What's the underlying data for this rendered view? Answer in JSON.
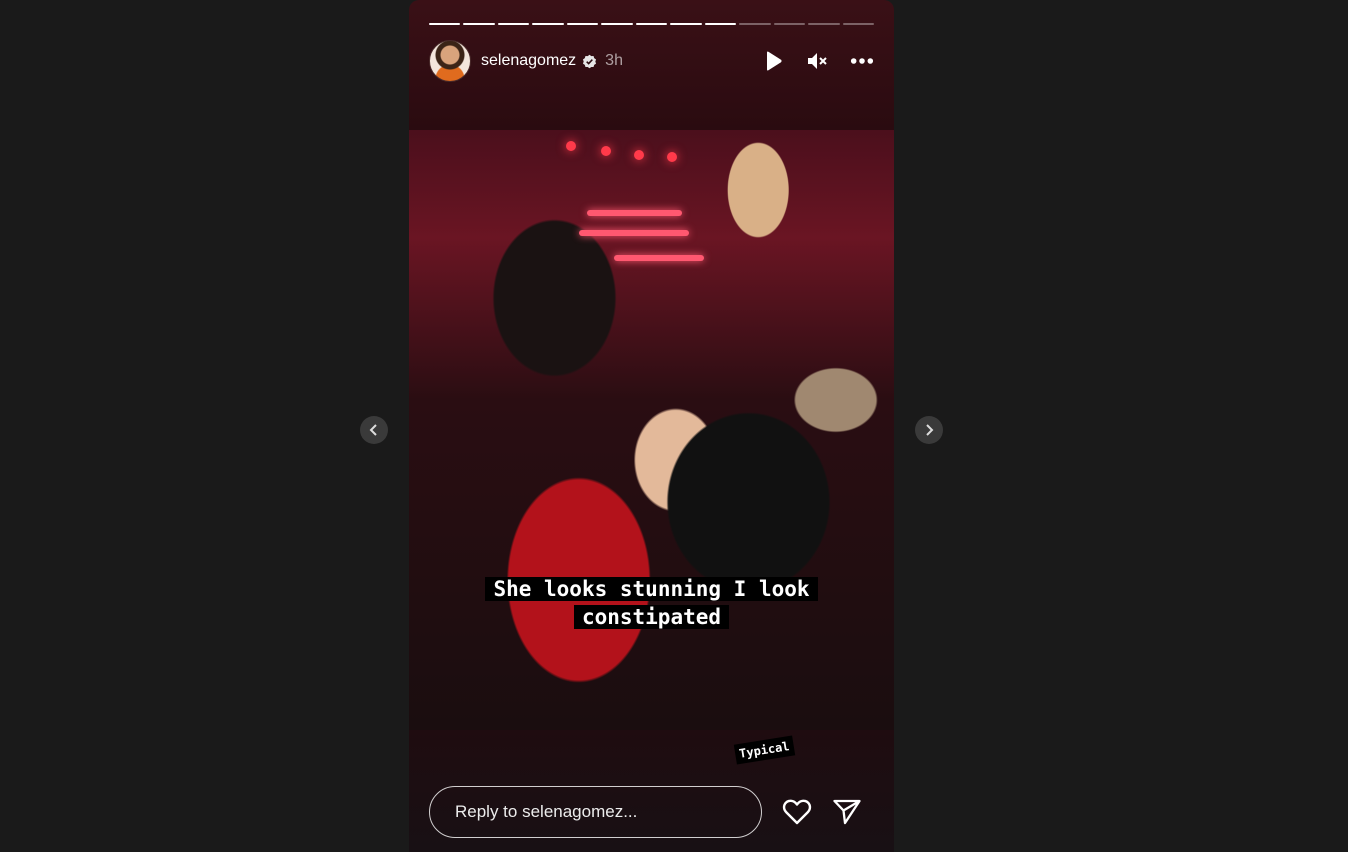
{
  "story": {
    "segments_total": 13,
    "segments_done": 9,
    "username": "selenagomez",
    "time": "3h",
    "verified": true,
    "caption_line1": "She looks stunning I look",
    "caption_line2": "constipated",
    "tag": "Typical",
    "reply_placeholder": "Reply to selenagomez..."
  },
  "icons": {
    "prev": "chevron-left-icon",
    "next": "chevron-right-icon",
    "play": "play-icon",
    "mute": "muted-speaker-icon",
    "more": "more-options-icon",
    "like": "heart-icon",
    "send": "send-icon"
  }
}
